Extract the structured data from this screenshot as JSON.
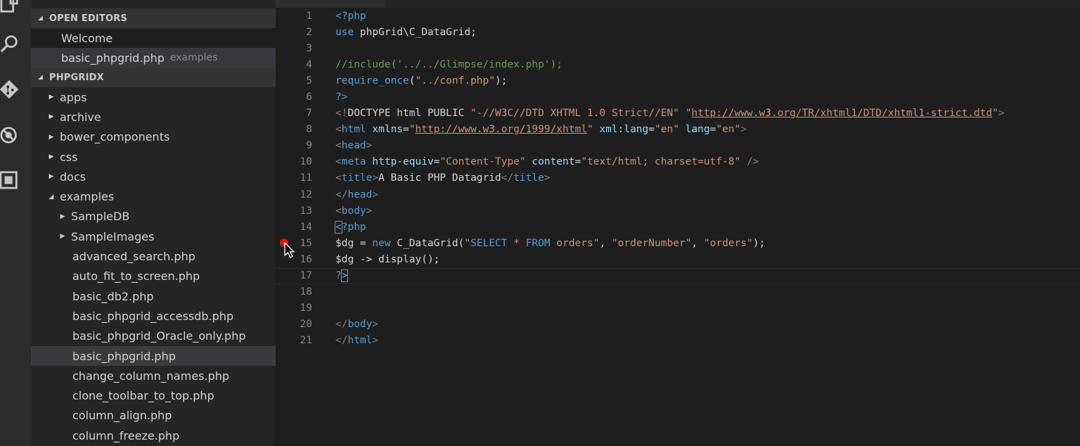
{
  "activity_bar": {
    "icons": [
      "explorer-icon",
      "search-icon",
      "source-control-icon",
      "debug-icon",
      "extensions-icon"
    ]
  },
  "sidebar": {
    "open_editors": {
      "title": "OPEN EDITORS",
      "items": [
        {
          "label": "Welcome",
          "description": ""
        },
        {
          "label": "basic_phpgrid.php",
          "description": "examples"
        }
      ]
    },
    "project": {
      "title": "PHPGRIDX",
      "items": [
        {
          "label": "apps",
          "type": "folder",
          "expanded": false,
          "level": 1
        },
        {
          "label": "archive",
          "type": "folder",
          "expanded": false,
          "level": 1
        },
        {
          "label": "bower_components",
          "type": "folder",
          "expanded": false,
          "level": 1
        },
        {
          "label": "css",
          "type": "folder",
          "expanded": false,
          "level": 1
        },
        {
          "label": "docs",
          "type": "folder",
          "expanded": false,
          "level": 1
        },
        {
          "label": "examples",
          "type": "folder",
          "expanded": true,
          "level": 1
        },
        {
          "label": "SampleDB",
          "type": "folder",
          "expanded": false,
          "level": 2
        },
        {
          "label": "SampleImages",
          "type": "folder",
          "expanded": false,
          "level": 2
        },
        {
          "label": "advanced_search.php",
          "type": "file",
          "level": 2
        },
        {
          "label": "auto_fit_to_screen.php",
          "type": "file",
          "level": 2
        },
        {
          "label": "basic_db2.php",
          "type": "file",
          "level": 2
        },
        {
          "label": "basic_phpgrid_accessdb.php",
          "type": "file",
          "level": 2
        },
        {
          "label": "basic_phpgrid_Oracle_only.php",
          "type": "file",
          "level": 2
        },
        {
          "label": "basic_phpgrid.php",
          "type": "file",
          "level": 2,
          "selected": true
        },
        {
          "label": "change_column_names.php",
          "type": "file",
          "level": 2
        },
        {
          "label": "clone_toolbar_to_top.php",
          "type": "file",
          "level": 2
        },
        {
          "label": "column_align.php",
          "type": "file",
          "level": 2
        },
        {
          "label": "column_freeze.php",
          "type": "file",
          "level": 2
        }
      ]
    }
  },
  "editor": {
    "breakpoint_line": 15,
    "current_line": 17,
    "colors": {
      "breakpoint": "#e51400",
      "keyword": "#569cd6",
      "string": "#ce9178",
      "comment": "#6a9955"
    },
    "lines": [
      {
        "n": "1",
        "tokens": [
          [
            "tag",
            "<?php"
          ]
        ]
      },
      {
        "n": "2",
        "tokens": [
          [
            "kw",
            "use"
          ],
          [
            "plain",
            " phpGrid\\C_DataGrid;"
          ]
        ]
      },
      {
        "n": "3",
        "tokens": []
      },
      {
        "n": "4",
        "tokens": [
          [
            "cmt",
            "//include('../../Glimpse/index.php');"
          ]
        ]
      },
      {
        "n": "5",
        "tokens": [
          [
            "kw",
            "require_once"
          ],
          [
            "plain",
            "("
          ],
          [
            "str",
            "\"../conf.php\""
          ],
          [
            "plain",
            ");"
          ]
        ]
      },
      {
        "n": "6",
        "tokens": [
          [
            "tag",
            "?>"
          ]
        ]
      },
      {
        "n": "7",
        "tokens": [
          [
            "punc",
            "<!"
          ],
          [
            "plain",
            "DOCTYPE html PUBLIC "
          ],
          [
            "str",
            "\"-//W3C//DTD XHTML 1.0 Strict//EN\""
          ],
          [
            "plain",
            " "
          ],
          [
            "str",
            "\""
          ],
          [
            "link",
            "http://www.w3.org/TR/xhtml1/DTD/xhtml1-strict.dtd"
          ],
          [
            "str",
            "\""
          ],
          [
            "punc",
            ">"
          ]
        ]
      },
      {
        "n": "8",
        "tokens": [
          [
            "punc",
            "<"
          ],
          [
            "tag",
            "html"
          ],
          [
            "plain",
            " "
          ],
          [
            "attr",
            "xmlns"
          ],
          [
            "plain",
            "="
          ],
          [
            "str",
            "\""
          ],
          [
            "link",
            "http://www.w3.org/1999/xhtml"
          ],
          [
            "str",
            "\""
          ],
          [
            "plain",
            " "
          ],
          [
            "attr",
            "xml:lang"
          ],
          [
            "plain",
            "="
          ],
          [
            "str",
            "\"en\""
          ],
          [
            "plain",
            " "
          ],
          [
            "attr",
            "lang"
          ],
          [
            "plain",
            "="
          ],
          [
            "str",
            "\"en\""
          ],
          [
            "punc",
            ">"
          ]
        ]
      },
      {
        "n": "9",
        "tokens": [
          [
            "punc",
            "<"
          ],
          [
            "tag",
            "head"
          ],
          [
            "punc",
            ">"
          ]
        ]
      },
      {
        "n": "10",
        "tokens": [
          [
            "punc",
            "<"
          ],
          [
            "tag",
            "meta"
          ],
          [
            "plain",
            " "
          ],
          [
            "attr",
            "http-equiv"
          ],
          [
            "plain",
            "="
          ],
          [
            "str",
            "\"Content-Type\""
          ],
          [
            "plain",
            " "
          ],
          [
            "attr",
            "content"
          ],
          [
            "plain",
            "="
          ],
          [
            "str",
            "\"text/html; charset=utf-8\""
          ],
          [
            "plain",
            " "
          ],
          [
            "punc",
            "/>"
          ]
        ]
      },
      {
        "n": "11",
        "tokens": [
          [
            "punc",
            "<"
          ],
          [
            "tag",
            "title"
          ],
          [
            "punc",
            ">"
          ],
          [
            "plain",
            "A Basic PHP Datagrid"
          ],
          [
            "punc",
            "</"
          ],
          [
            "tag",
            "title"
          ],
          [
            "punc",
            ">"
          ]
        ]
      },
      {
        "n": "12",
        "tokens": [
          [
            "punc",
            "</"
          ],
          [
            "tag",
            "head"
          ],
          [
            "punc",
            ">"
          ]
        ]
      },
      {
        "n": "13",
        "tokens": [
          [
            "punc",
            "<"
          ],
          [
            "tag",
            "body"
          ],
          [
            "punc",
            ">"
          ]
        ]
      },
      {
        "n": "14",
        "tokens": [
          [
            "bracket",
            "<"
          ],
          [
            "tag",
            "?php"
          ]
        ]
      },
      {
        "n": "15",
        "tokens": [
          [
            "plain",
            "$dg = "
          ],
          [
            "kw",
            "new"
          ],
          [
            "plain",
            " C_DataGrid("
          ],
          [
            "str",
            "\""
          ],
          [
            "kw",
            "SELECT"
          ],
          [
            "str",
            " * "
          ],
          [
            "kw",
            "FROM"
          ],
          [
            "str",
            " orders\""
          ],
          [
            "plain",
            ", "
          ],
          [
            "str",
            "\"orderNumber\""
          ],
          [
            "plain",
            ", "
          ],
          [
            "str",
            "\"orders\""
          ],
          [
            "plain",
            ");"
          ]
        ]
      },
      {
        "n": "16",
        "tokens": [
          [
            "plain",
            "$dg -> display();"
          ]
        ]
      },
      {
        "n": "17",
        "tokens": [
          [
            "tag",
            "?"
          ],
          [
            "bracket",
            ">"
          ]
        ]
      },
      {
        "n": "18",
        "tokens": []
      },
      {
        "n": "19",
        "tokens": []
      },
      {
        "n": "20",
        "tokens": [
          [
            "punc",
            "</"
          ],
          [
            "tag",
            "body"
          ],
          [
            "punc",
            ">"
          ]
        ]
      },
      {
        "n": "21",
        "tokens": [
          [
            "punc",
            "</"
          ],
          [
            "tag",
            "html"
          ],
          [
            "punc",
            ">"
          ]
        ]
      }
    ]
  }
}
